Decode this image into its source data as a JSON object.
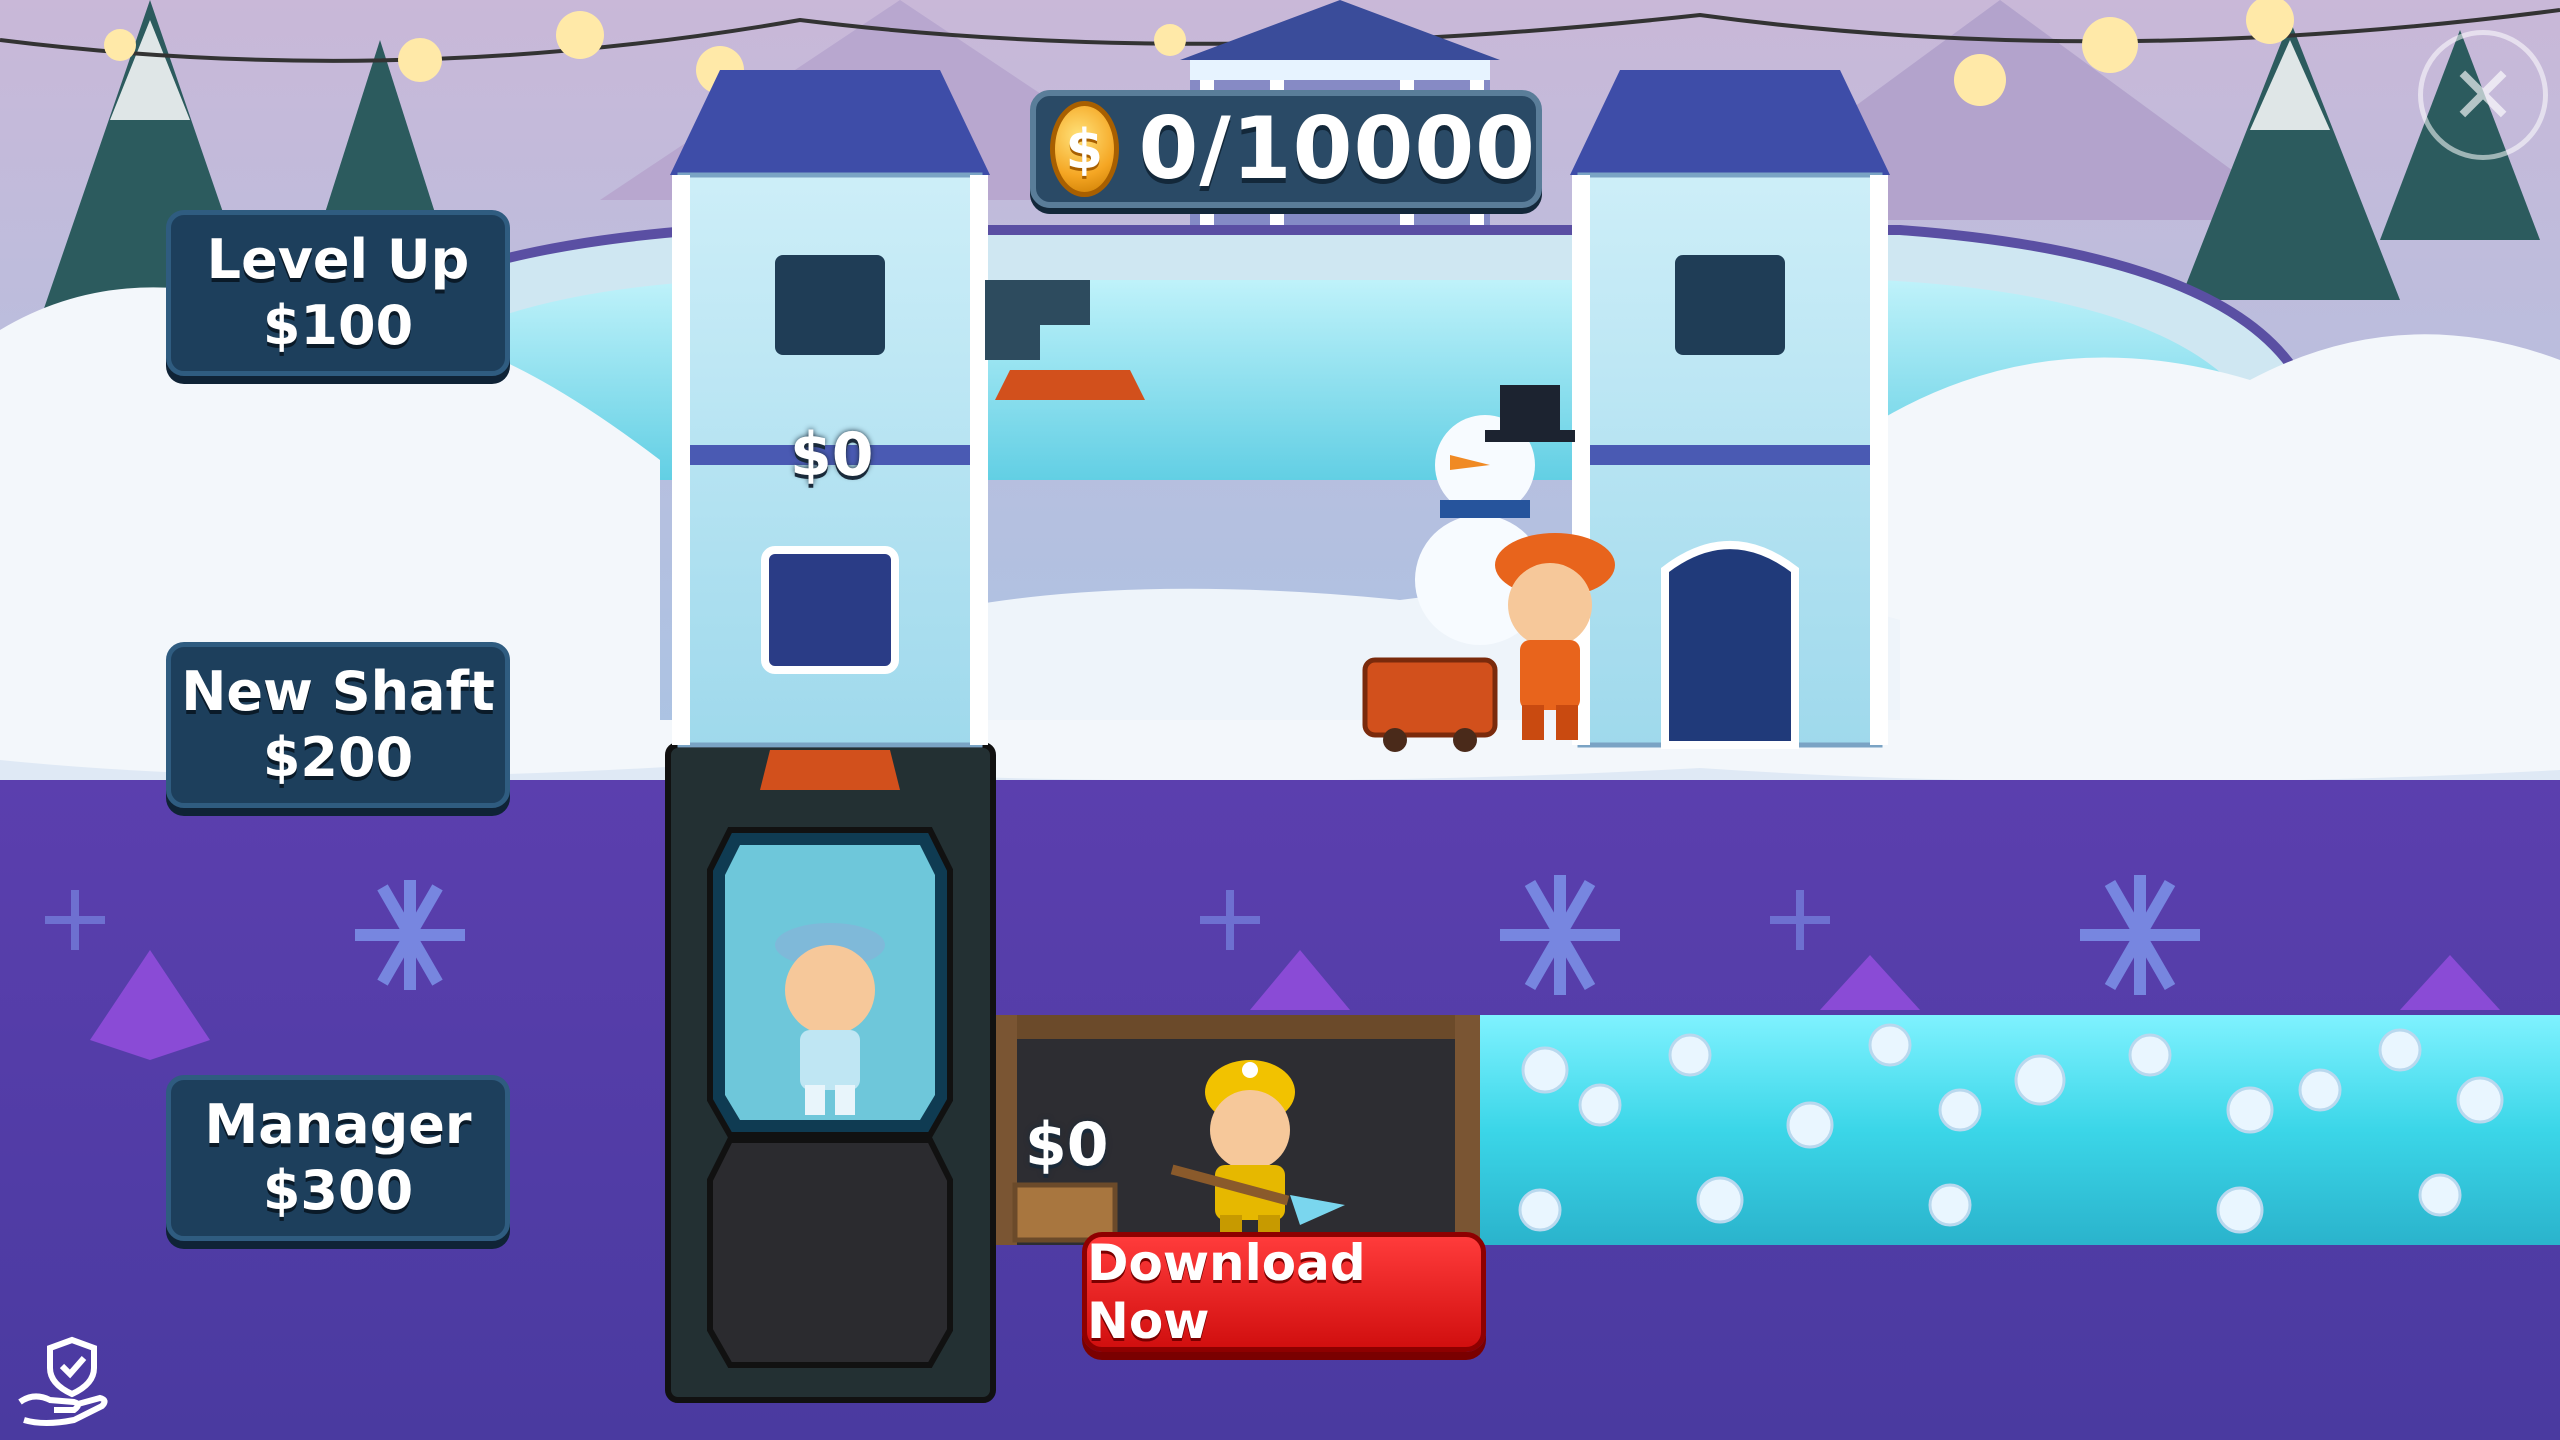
{
  "hud": {
    "coin_icon_symbol": "$",
    "coin_counter": "0/10000"
  },
  "side_buttons": [
    {
      "title": "Level Up",
      "price": "$100"
    },
    {
      "title": "New Shaft",
      "price": "$200"
    },
    {
      "title": "Manager",
      "price": "$300"
    }
  ],
  "elevator_storage_value": "$0",
  "mine_shaft_value": "$0",
  "download_button": "Download Now",
  "close_button_symbol": "✕",
  "icons": {
    "coin": "gold-coin-icon",
    "close": "close-icon",
    "privacy": "shield-hand-icon"
  },
  "colors": {
    "sky": "#9fb4d6",
    "ice": "#7fe0f0",
    "underground": "#5a4bb0",
    "button_bg": "#1d3f5c",
    "download_red": "#e81c1c",
    "coin_gold": "#f5a623"
  }
}
